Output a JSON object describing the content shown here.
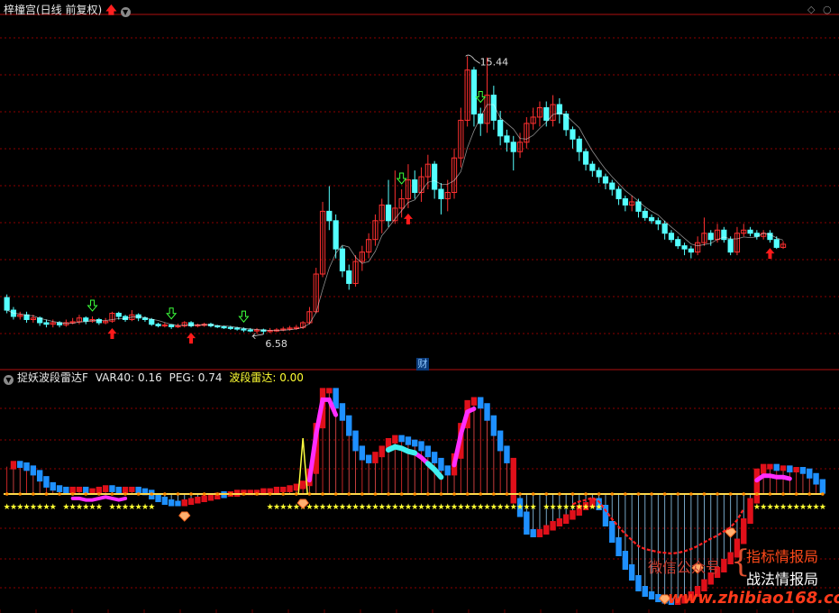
{
  "header": {
    "title": "梓橦宫(日线 前复权)",
    "corner_icons": [
      "diamond-icon",
      "circle-icon"
    ]
  },
  "indicator": {
    "name": "捉妖波段雷达F",
    "var40_label": "VAR40:",
    "var40_value": "0.16",
    "peg_label": "PEG:",
    "peg_value": "0.74",
    "wave_label": "波段雷达:",
    "wave_value": "0.00"
  },
  "annotations": {
    "high": "15.44",
    "low": "6.58",
    "cai_badge": "财"
  },
  "watermark": {
    "weixin": "微信公众号",
    "line1": "指标情报局",
    "line2": "战法情报局",
    "url": "www.zhibiao168.com"
  },
  "chart_data": {
    "type": "candlestick",
    "colors": {
      "up": "#ff3030",
      "down": "#54ffff",
      "ma": "#ffffff",
      "bg": "#000000",
      "grid": "#8b0000"
    },
    "ylim": [
      5.8,
      16.6
    ],
    "high_value": 15.44,
    "low_value": 6.58,
    "candles": [
      [
        7.75,
        7.35,
        7.85,
        7.25
      ],
      [
        7.35,
        7.15,
        7.45,
        7.05
      ],
      [
        7.15,
        7.2,
        7.3,
        7.05
      ],
      [
        7.2,
        7.05,
        7.3,
        6.95
      ],
      [
        7.05,
        7.1,
        7.2,
        6.95
      ],
      [
        7.1,
        6.95,
        7.15,
        6.85
      ],
      [
        6.95,
        6.9,
        7.05,
        6.8
      ],
      [
        6.9,
        6.95,
        7.05,
        6.8
      ],
      [
        6.95,
        6.88,
        7.0,
        6.8
      ],
      [
        6.88,
        6.95,
        7.05,
        6.82
      ],
      [
        6.95,
        6.98,
        7.1,
        6.9
      ],
      [
        6.98,
        7.1,
        7.2,
        6.9
      ],
      [
        7.1,
        7.0,
        7.15,
        6.9
      ],
      [
        7.0,
        7.05,
        7.15,
        6.95
      ],
      [
        7.05,
        6.95,
        7.1,
        6.88
      ],
      [
        6.95,
        7.0,
        7.1,
        6.9
      ],
      [
        7.0,
        7.25,
        7.3,
        6.95
      ],
      [
        7.25,
        7.15,
        7.3,
        7.05
      ],
      [
        7.15,
        7.05,
        7.2,
        6.98
      ],
      [
        7.05,
        7.2,
        7.35,
        7.0
      ],
      [
        7.2,
        7.1,
        7.25,
        7.0
      ],
      [
        7.1,
        7.05,
        7.15,
        6.98
      ],
      [
        7.05,
        6.9,
        7.1,
        6.85
      ],
      [
        6.9,
        6.85,
        6.95,
        6.8
      ],
      [
        6.85,
        6.88,
        6.95,
        6.8
      ],
      [
        6.88,
        6.82,
        6.9,
        6.75
      ],
      [
        6.82,
        6.85,
        6.92,
        6.78
      ],
      [
        6.85,
        6.95,
        7.0,
        6.8
      ],
      [
        6.95,
        6.85,
        7.0,
        6.8
      ],
      [
        6.85,
        6.88,
        6.92,
        6.8
      ],
      [
        6.88,
        6.9,
        6.95,
        6.82
      ],
      [
        6.9,
        6.85,
        6.95,
        6.8
      ],
      [
        6.85,
        6.82,
        6.88,
        6.78
      ],
      [
        6.82,
        6.8,
        6.85,
        6.75
      ],
      [
        6.8,
        6.78,
        6.85,
        6.72
      ],
      [
        6.78,
        6.75,
        6.82,
        6.7
      ],
      [
        6.75,
        6.72,
        6.8,
        6.65
      ],
      [
        6.72,
        6.7,
        6.78,
        6.65
      ],
      [
        6.7,
        6.72,
        6.78,
        6.6
      ],
      [
        6.72,
        6.68,
        6.76,
        6.58
      ],
      [
        6.68,
        6.7,
        6.78,
        6.62
      ],
      [
        6.7,
        6.72,
        6.78,
        6.65
      ],
      [
        6.72,
        6.75,
        6.82,
        6.68
      ],
      [
        6.75,
        6.78,
        6.85,
        6.7
      ],
      [
        6.78,
        6.8,
        6.88,
        6.72
      ],
      [
        6.8,
        6.95,
        7.0,
        6.75
      ],
      [
        6.95,
        7.3,
        7.45,
        6.9
      ],
      [
        7.3,
        8.5,
        8.7,
        7.25
      ],
      [
        8.5,
        10.5,
        10.8,
        8.4
      ],
      [
        10.5,
        10.2,
        11.3,
        9.9
      ],
      [
        10.2,
        9.3,
        10.4,
        9.0
      ],
      [
        9.3,
        8.6,
        9.4,
        8.4
      ],
      [
        8.6,
        8.2,
        8.8,
        8.0
      ],
      [
        8.2,
        8.9,
        9.1,
        8.1
      ],
      [
        8.9,
        9.2,
        9.4,
        8.6
      ],
      [
        9.2,
        9.6,
        9.8,
        9.0
      ],
      [
        9.6,
        10.2,
        10.4,
        9.4
      ],
      [
        10.2,
        10.7,
        10.9,
        9.8
      ],
      [
        10.7,
        10.2,
        11.5,
        10.0
      ],
      [
        10.2,
        10.6,
        11.8,
        10.1
      ],
      [
        10.6,
        10.9,
        11.2,
        10.3
      ],
      [
        10.9,
        11.5,
        12.0,
        10.6
      ],
      [
        11.5,
        11.1,
        11.8,
        10.9
      ],
      [
        11.1,
        11.6,
        11.9,
        10.8
      ],
      [
        11.6,
        12.0,
        12.3,
        11.2
      ],
      [
        12.0,
        11.2,
        12.1,
        10.9
      ],
      [
        11.2,
        10.9,
        11.4,
        10.4
      ],
      [
        10.9,
        11.1,
        11.5,
        10.5
      ],
      [
        11.1,
        12.2,
        12.5,
        10.9
      ],
      [
        12.2,
        13.4,
        13.8,
        11.9
      ],
      [
        13.4,
        15.0,
        15.44,
        13.2
      ],
      [
        15.0,
        13.6,
        15.1,
        13.2
      ],
      [
        13.6,
        13.3,
        13.8,
        12.9
      ],
      [
        13.3,
        14.2,
        15.4,
        13.0
      ],
      [
        14.2,
        13.4,
        14.5,
        13.1
      ],
      [
        13.4,
        12.9,
        13.7,
        12.6
      ],
      [
        12.9,
        12.7,
        13.1,
        12.4
      ],
      [
        12.7,
        12.4,
        12.9,
        11.8
      ],
      [
        12.4,
        12.7,
        13.0,
        12.2
      ],
      [
        12.7,
        13.3,
        13.5,
        12.5
      ],
      [
        13.3,
        13.5,
        13.8,
        13.1
      ],
      [
        13.5,
        13.8,
        14.0,
        13.2
      ],
      [
        13.8,
        13.4,
        14.0,
        13.2
      ],
      [
        13.4,
        13.9,
        14.2,
        13.2
      ],
      [
        13.9,
        13.6,
        14.1,
        13.3
      ],
      [
        13.6,
        13.1,
        13.7,
        12.9
      ],
      [
        13.1,
        12.8,
        13.2,
        12.5
      ],
      [
        12.8,
        12.4,
        12.9,
        12.1
      ],
      [
        12.4,
        12.0,
        12.5,
        11.8
      ],
      [
        12.0,
        11.8,
        12.1,
        11.6
      ],
      [
        11.8,
        11.6,
        11.9,
        11.4
      ],
      [
        11.6,
        11.4,
        11.7,
        11.2
      ],
      [
        11.4,
        11.2,
        11.5,
        11.0
      ],
      [
        11.2,
        10.9,
        11.3,
        10.7
      ],
      [
        10.9,
        10.7,
        11.0,
        10.5
      ],
      [
        10.7,
        10.8,
        11.0,
        10.5
      ],
      [
        10.8,
        10.5,
        10.9,
        10.3
      ],
      [
        10.5,
        10.3,
        10.6,
        10.2
      ],
      [
        10.3,
        10.2,
        10.4,
        10.1
      ],
      [
        10.2,
        10.1,
        10.3,
        9.9
      ],
      [
        10.1,
        9.8,
        10.2,
        9.6
      ],
      [
        9.8,
        9.6,
        9.9,
        9.5
      ],
      [
        9.6,
        9.4,
        9.7,
        9.3
      ],
      [
        9.4,
        9.3,
        9.5,
        9.1
      ],
      [
        9.3,
        9.2,
        9.4,
        9.0
      ],
      [
        9.2,
        9.5,
        9.7,
        9.1
      ],
      [
        9.5,
        9.8,
        10.3,
        9.4
      ],
      [
        9.8,
        9.6,
        9.9,
        9.4
      ],
      [
        9.6,
        9.9,
        10.1,
        9.5
      ],
      [
        9.9,
        9.6,
        10.0,
        9.5
      ],
      [
        9.6,
        9.2,
        9.7,
        9.1
      ],
      [
        9.2,
        9.8,
        10.0,
        9.1
      ],
      [
        9.8,
        9.9,
        10.1,
        9.7
      ],
      [
        9.9,
        9.8,
        10.0,
        9.7
      ],
      [
        9.8,
        9.7,
        9.9,
        9.6
      ],
      [
        9.7,
        9.8,
        9.9,
        9.6
      ],
      [
        9.8,
        9.6,
        9.9,
        9.5
      ],
      [
        9.6,
        9.35,
        9.7,
        9.3
      ],
      [
        9.35,
        9.45,
        9.55,
        9.3
      ]
    ],
    "buy_signals": [
      16,
      28,
      61,
      116
    ],
    "sell_signals": [
      13,
      25,
      36,
      60,
      72
    ],
    "indicator_series": {
      "bars": [
        0.18,
        0.2,
        0.19,
        0.17,
        0.14,
        0.1,
        0.06,
        0.04,
        0.03,
        0.02,
        0.03,
        0.03,
        0.02,
        0.02,
        0.03,
        0.04,
        0.03,
        0.02,
        0.03,
        0.03,
        0.02,
        0.01,
        -0.02,
        -0.04,
        -0.06,
        -0.07,
        -0.07,
        -0.06,
        -0.05,
        -0.04,
        -0.03,
        -0.02,
        -0.01,
        0.0,
        0.0,
        0.01,
        0.01,
        0.01,
        0.01,
        0.02,
        0.02,
        0.03,
        0.03,
        0.04,
        0.05,
        0.07,
        0.15,
        0.45,
        0.68,
        0.68,
        0.58,
        0.5,
        0.4,
        0.3,
        0.24,
        0.22,
        0.26,
        0.3,
        0.35,
        0.37,
        0.36,
        0.34,
        0.33,
        0.3,
        0.26,
        0.22,
        0.17,
        0.14,
        0.25,
        0.45,
        0.6,
        0.62,
        0.58,
        0.5,
        0.4,
        0.3,
        0.22,
        -0.05,
        -0.15,
        -0.28,
        -0.3,
        -0.28,
        -0.25,
        -0.22,
        -0.2,
        -0.17,
        -0.14,
        -0.1,
        -0.08,
        -0.05,
        -0.1,
        -0.22,
        -0.34,
        -0.44,
        -0.54,
        -0.62,
        -0.7,
        -0.74,
        -0.76,
        -0.78,
        -0.79,
        -0.8,
        -0.79,
        -0.77,
        -0.74,
        -0.7,
        -0.65,
        -0.6,
        -0.56,
        -0.5,
        -0.45,
        -0.35,
        -0.2,
        -0.05,
        0.15,
        0.18,
        0.18,
        0.17,
        0.17,
        0.16,
        0.16,
        0.15,
        0.12,
        0.08,
        0.02
      ],
      "star_line_value": 0.0
    }
  }
}
